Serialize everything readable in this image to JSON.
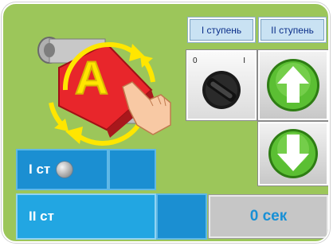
{
  "tabs": {
    "stage1_label": "I ступень",
    "stage2_label": "II ступень"
  },
  "selector": {
    "pos0_label": "0",
    "pos1_label": "I"
  },
  "stages": {
    "stage1_label": "I ст",
    "stage2_label": "II ст"
  },
  "timer": {
    "value": "0 сек"
  },
  "auto_button": {
    "letter": "A"
  },
  "colors": {
    "panel_bg": "#9cc65a",
    "stage_blue": "#1b8fd2",
    "auto_yellow": "#ffe600",
    "arrow_green": "#4fb52a",
    "timer_text": "#1890d6"
  },
  "icons": {
    "auto_mode": "auto-mode-icon",
    "hand": "hand-pointer-icon",
    "rotary_switch": "rotary-switch-icon",
    "up": "arrow-up-icon",
    "down": "arrow-down-icon",
    "lamp": "indicator-lamp-icon"
  }
}
